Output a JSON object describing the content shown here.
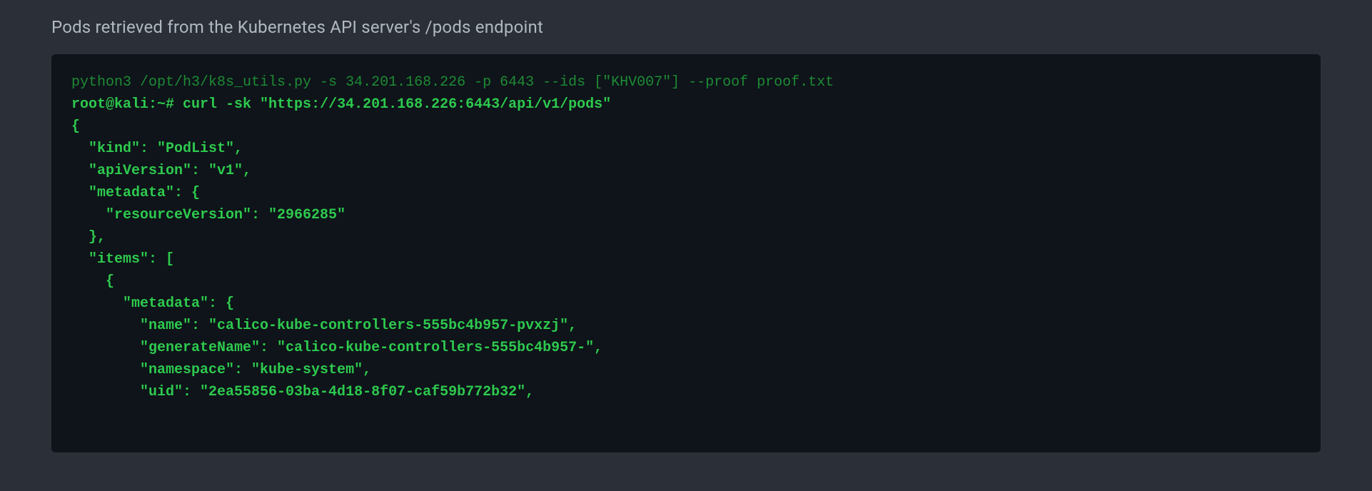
{
  "caption": "Pods retrieved from the Kubernetes API server's /pods endpoint",
  "terminal": {
    "line1": "python3 /opt/h3/k8s_utils.py -s 34.201.168.226 -p 6443 --ids [\"KHV007\"] --proof proof.txt",
    "prompt": "root@kali:~#",
    "command": " curl -sk \"https://34.201.168.226:6443/api/v1/pods\"",
    "output": "{\n  \"kind\": \"PodList\",\n  \"apiVersion\": \"v1\",\n  \"metadata\": {\n    \"resourceVersion\": \"2966285\"\n  },\n  \"items\": [\n    {\n      \"metadata\": {\n        \"name\": \"calico-kube-controllers-555bc4b957-pvxzj\",\n        \"generateName\": \"calico-kube-controllers-555bc4b957-\",\n        \"namespace\": \"kube-system\",\n        \"uid\": \"2ea55856-03ba-4d18-8f07-caf59b772b32\","
  }
}
